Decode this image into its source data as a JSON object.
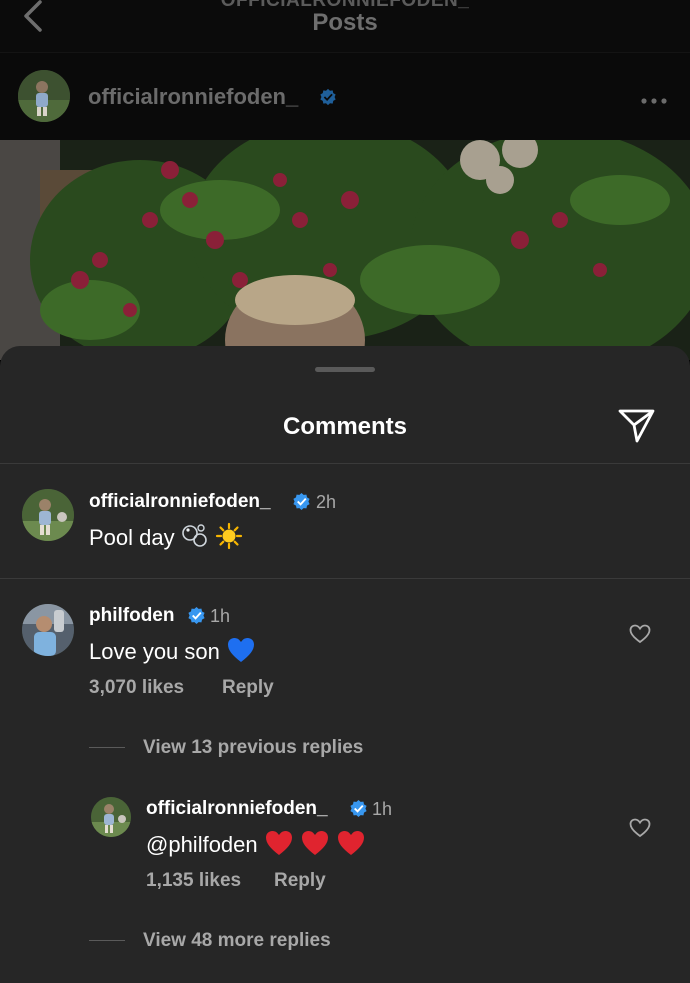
{
  "header": {
    "supertitle": "OFFICIALRONNIEFODEN_",
    "title": "Posts"
  },
  "post": {
    "username": "officialronniefoden_",
    "verified": true
  },
  "comments_sheet": {
    "title": "Comments",
    "caption": {
      "username": "officialronniefoden_",
      "time": "2h",
      "text": "Pool day",
      "emojis": [
        "bubbles",
        "sun"
      ]
    },
    "comment": {
      "username": "philfoden",
      "time": "1h",
      "text": "Love you son",
      "emoji": "blue-heart",
      "likes": "3,070 likes",
      "reply_label": "Reply"
    },
    "view_previous": "View 13 previous replies",
    "reply": {
      "username": "officialronniefoden_",
      "time": "1h",
      "mention": "@philfoden",
      "emojis": [
        "red-heart",
        "red-heart",
        "red-heart"
      ],
      "likes": "1,135 likes",
      "reply_label": "Reply"
    },
    "view_more": "View 48 more replies"
  },
  "colors": {
    "sheet_bg": "#262626",
    "verified_blue": "#3897f0",
    "muted_text": "#a8a8a8"
  }
}
